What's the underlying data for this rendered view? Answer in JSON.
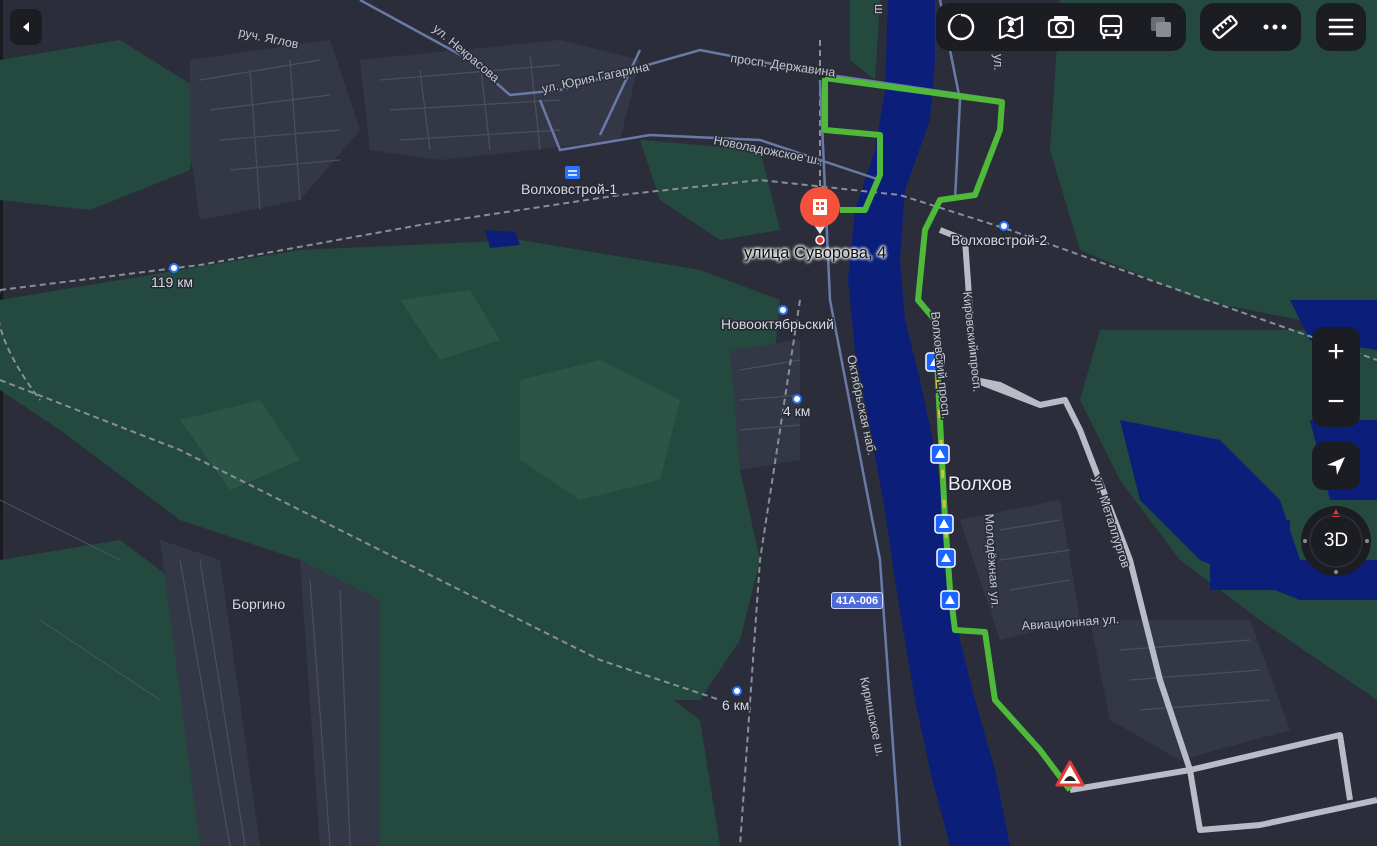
{
  "map": {
    "address_label": "улица Суворова, 4",
    "city_label": "Волхов",
    "route_colors": {
      "route": "#4fb93a",
      "water": "#0a1e7a",
      "forest": "#24493e",
      "land": "#2b2e3a"
    },
    "places": {
      "volkhovstroy1": "Волховстрой-1",
      "volkhovstroy2": "Волховстрой-2",
      "novooktyabrsky": "Новооктябрьский",
      "km119": "119 км",
      "km4": "4 км",
      "km6": "6 км",
      "borgino": "Боргино"
    },
    "streets": {
      "yaglov": "руч. Яглов",
      "nekrasova": "ул. Некрасова",
      "gagarina": "ул. Юрия Гагарина",
      "derzhavina": "просп. Державина",
      "novoladozhskoe": "Новоладожское ш.",
      "oktyabrskaya": "Октябрьская наб.",
      "kirishskoe": "Киришское ш.",
      "volkhovsky": "Волховский просп.",
      "kirovsky": "Кировский просп.",
      "molodezhnaya": "Молодёжная ул.",
      "aviatsionnaya": "Авиационная ул.",
      "metallurgov": "ул. Металлургов",
      "top_edge": "ш",
      "top_right": "ул."
    },
    "road_shield": "41А-006"
  },
  "controls": {
    "collapse_icon": "triangle-left-icon",
    "toolbar_icons": [
      "layers-circle-icon",
      "panorama-map-icon",
      "camera-icon",
      "bus-icon",
      "layers-square-icon"
    ],
    "tools_icons": [
      "ruler-icon",
      "more-icon"
    ],
    "menu_icon": "hamburger-icon",
    "zoom_in": "+",
    "zoom_out": "−",
    "mode_3d": "3D"
  }
}
